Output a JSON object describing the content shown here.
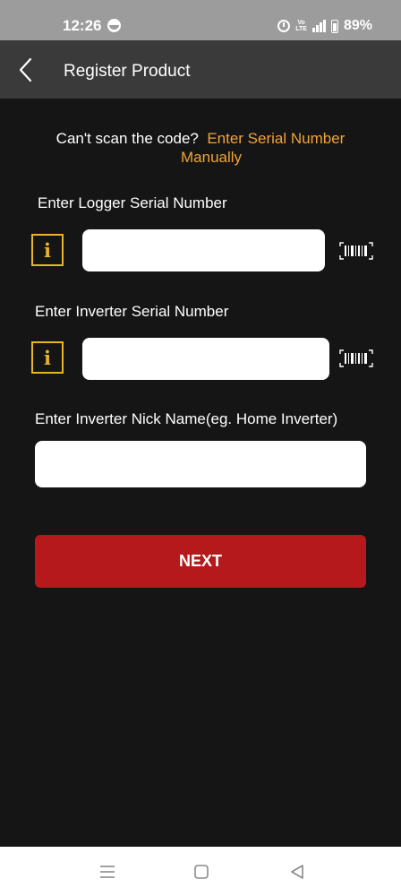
{
  "status_bar": {
    "time": "12:26",
    "battery_text": "89%",
    "volte_line1": "Vo",
    "volte_line2": "LTE",
    "icons": [
      "data-saver-icon",
      "alarm-icon",
      "volte-icon",
      "signal-icon",
      "battery-icon"
    ]
  },
  "app_bar": {
    "title": "Register Product",
    "back_icon": "chevron-left-icon"
  },
  "scan_prompt": {
    "prefix": "Can't scan the code?",
    "link_line1": "Enter Serial Number",
    "link_line2": "Manually"
  },
  "form": {
    "logger": {
      "label": "Enter Logger Serial Number",
      "value": "",
      "info_glyph": "i",
      "scan_icon": "barcode-scan-icon"
    },
    "inverter": {
      "label": "Enter Inverter Serial Number",
      "value": "",
      "info_glyph": "i",
      "scan_icon": "barcode-scan-icon"
    },
    "nickname": {
      "label": "Enter Inverter Nick Name(eg. Home Inverter)",
      "value": ""
    }
  },
  "next_button": {
    "label": "NEXT"
  },
  "nav_bar": {
    "items": [
      "menu-icon",
      "home-square-icon",
      "back-triangle-icon"
    ]
  },
  "colors": {
    "background": "#151515",
    "status_bar": "#9c9c9c",
    "app_bar": "#3a3a3a",
    "link": "#f1a43a",
    "info_accent": "#e7b528",
    "primary_button": "#b5191b",
    "input_background": "#ffffff"
  }
}
